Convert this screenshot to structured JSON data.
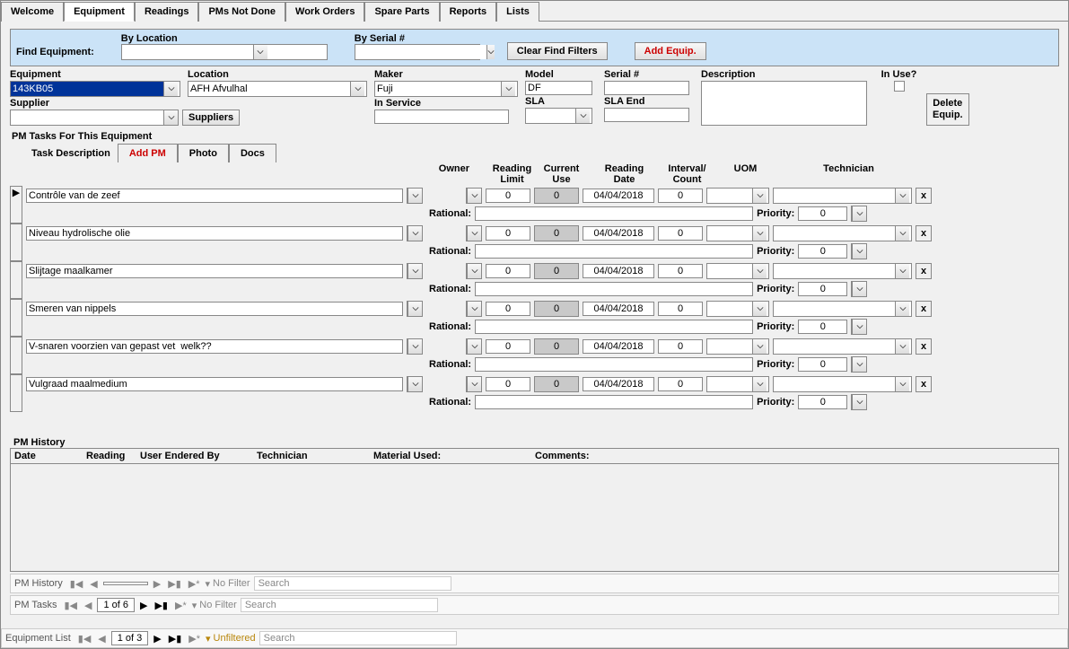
{
  "tabs": [
    "Welcome",
    "Equipment",
    "Readings",
    "PMs Not Done",
    "Work Orders",
    "Spare Parts",
    "Reports",
    "Lists"
  ],
  "active_tab": "Equipment",
  "find": {
    "label": "Find Equipment:",
    "by_location_label": "By Location",
    "by_serial_label": "By Serial #",
    "by_location_value": "",
    "by_serial_value": "",
    "clear_btn": "Clear Find Filters",
    "add_btn": "Add Equip."
  },
  "eq": {
    "labels": {
      "equipment": "Equipment",
      "location": "Location",
      "maker": "Maker",
      "model": "Model",
      "serial": "Serial #",
      "description": "Description",
      "in_use": "In Use?",
      "supplier": "Supplier",
      "suppliers_btn": "Suppliers",
      "in_service": "In Service",
      "sla": "SLA",
      "sla_end": "SLA End",
      "delete_btn_l1": "Delete",
      "delete_btn_l2": "Equip."
    },
    "values": {
      "equipment": "143KB05",
      "location": "AFH Afvulhal",
      "maker": "Fuji",
      "model": "DF",
      "serial": "",
      "description": "",
      "in_use": false,
      "supplier": "",
      "in_service": "",
      "sla": "",
      "sla_end": ""
    }
  },
  "pm": {
    "section_title": "PM Tasks For This Equipment",
    "task_desc_label": "Task Description",
    "add_pm_btn": "Add PM",
    "photo_btn": "Photo",
    "docs_btn": "Docs",
    "cols": {
      "owner": "Owner",
      "reading_limit_l1": "Reading",
      "reading_limit_l2": "Limit",
      "current_use_l1": "Current",
      "current_use_l2": "Use",
      "reading_date_l1": "Reading",
      "reading_date_l2": "Date",
      "interval_l1": "Interval/",
      "interval_l2": "Count",
      "uom": "UOM",
      "technician": "Technician"
    },
    "rational_label": "Rational:",
    "priority_label": "Priority:",
    "x_label": "x",
    "tasks": [
      {
        "desc": "Contrôle van de zeef",
        "owner": "",
        "reading_limit": "0",
        "current_use": "0",
        "reading_date": "04/04/2018",
        "interval": "0",
        "uom": "",
        "technician": "",
        "rational": "",
        "priority": "0"
      },
      {
        "desc": "Niveau hydrolische olie",
        "owner": "",
        "reading_limit": "0",
        "current_use": "0",
        "reading_date": "04/04/2018",
        "interval": "0",
        "uom": "",
        "technician": "",
        "rational": "",
        "priority": "0"
      },
      {
        "desc": "Slijtage maalkamer",
        "owner": "",
        "reading_limit": "0",
        "current_use": "0",
        "reading_date": "04/04/2018",
        "interval": "0",
        "uom": "",
        "technician": "",
        "rational": "",
        "priority": "0"
      },
      {
        "desc": "Smeren van nippels",
        "owner": "",
        "reading_limit": "0",
        "current_use": "0",
        "reading_date": "04/04/2018",
        "interval": "0",
        "uom": "",
        "technician": "",
        "rational": "",
        "priority": "0"
      },
      {
        "desc": "V-snaren voorzien van gepast vet  welk??",
        "owner": "",
        "reading_limit": "0",
        "current_use": "0",
        "reading_date": "04/04/2018",
        "interval": "0",
        "uom": "",
        "technician": "",
        "rational": "",
        "priority": "0"
      },
      {
        "desc": "Vulgraad maalmedium",
        "owner": "",
        "reading_limit": "0",
        "current_use": "0",
        "reading_date": "04/04/2018",
        "interval": "0",
        "uom": "",
        "technician": "",
        "rational": "",
        "priority": "0"
      }
    ]
  },
  "history": {
    "title": "PM History",
    "cols": {
      "date": "Date",
      "reading": "Reading",
      "user": "User Endered By",
      "technician": "Technician",
      "material": "Material Used:",
      "comments": "Comments:"
    }
  },
  "nav": {
    "pm_history": {
      "label": "PM History",
      "count": "",
      "filter": "No Filter",
      "search": "Search"
    },
    "pm_tasks": {
      "label": "PM Tasks",
      "count": "1 of 6",
      "filter": "No Filter",
      "search": "Search"
    },
    "equipment_list": {
      "label": "Equipment List",
      "count": "1 of 3",
      "filter": "Unfiltered",
      "search": "Search"
    }
  }
}
